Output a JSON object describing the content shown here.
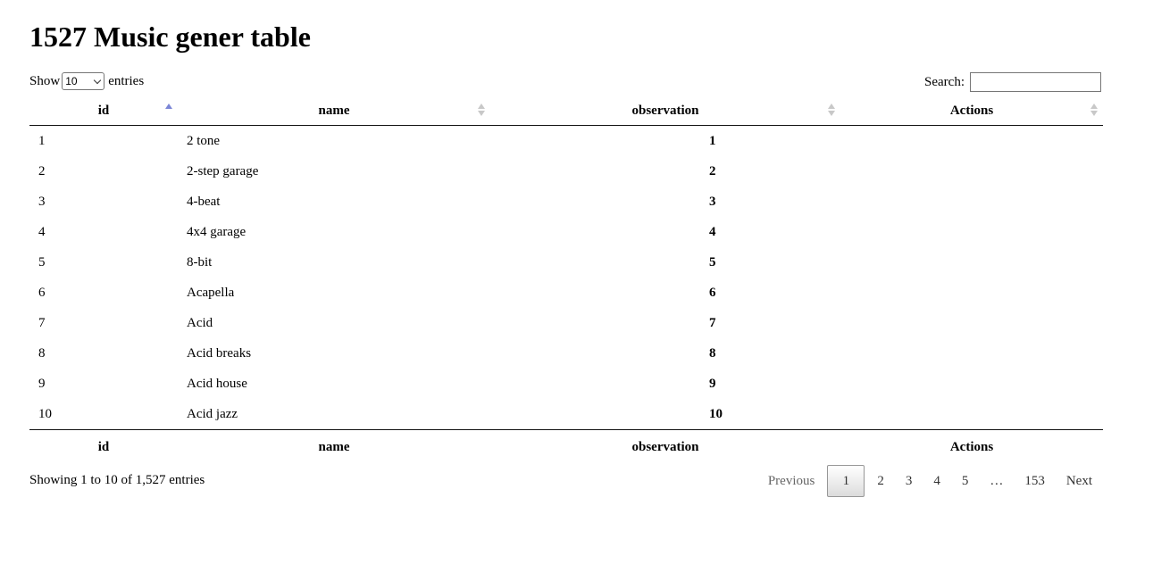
{
  "page_title": "1527 Music gener table",
  "length": {
    "show_label": "Show",
    "selected": "10",
    "entries_label": "entries"
  },
  "search": {
    "label": "Search:",
    "value": ""
  },
  "columns": [
    "id",
    "name",
    "observation",
    "Actions"
  ],
  "rows": [
    {
      "id": "1",
      "name": "2 tone",
      "observation": "1",
      "actions": ""
    },
    {
      "id": "2",
      "name": "2-step garage",
      "observation": "2",
      "actions": ""
    },
    {
      "id": "3",
      "name": "4-beat",
      "observation": "3",
      "actions": ""
    },
    {
      "id": "4",
      "name": "4x4 garage",
      "observation": "4",
      "actions": ""
    },
    {
      "id": "5",
      "name": "8-bit",
      "observation": "5",
      "actions": ""
    },
    {
      "id": "6",
      "name": "Acapella",
      "observation": "6",
      "actions": ""
    },
    {
      "id": "7",
      "name": "Acid",
      "observation": "7",
      "actions": ""
    },
    {
      "id": "8",
      "name": "Acid breaks",
      "observation": "8",
      "actions": ""
    },
    {
      "id": "9",
      "name": "Acid house",
      "observation": "9",
      "actions": ""
    },
    {
      "id": "10",
      "name": "Acid jazz",
      "observation": "10",
      "actions": ""
    }
  ],
  "info": "Showing 1 to 10 of 1,527 entries",
  "pagination": {
    "previous": "Previous",
    "pages": [
      "1",
      "2",
      "3",
      "4",
      "5"
    ],
    "ellipsis": "…",
    "last": "153",
    "next": "Next",
    "current": "1"
  },
  "colors": {
    "sort_active": "#7b86d6",
    "sort_inactive": "#c8c8c8"
  },
  "icons": {
    "sort_asc": "sort-asc-icon",
    "sort_both": "sort-both-icon",
    "dropdown": "chevron-down-icon"
  }
}
